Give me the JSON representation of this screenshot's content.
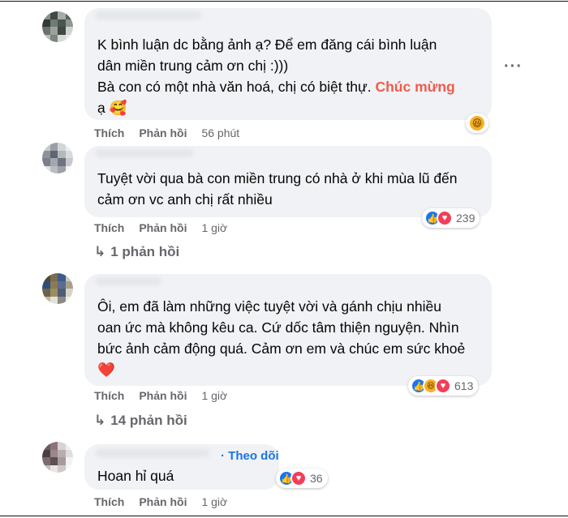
{
  "comments": [
    {
      "lines": [
        "K bình luận dc bằng ảnh ạ? Để em đăng cái bình luận",
        "dân miền trung cảm ơn chị :)))",
        "Bà con có một nhà văn hoá, chị có biệt thự. "
      ],
      "highlight": "Chúc mừng",
      "last_line": "ạ 🥰",
      "like": "Thích",
      "reply": "Phản hồi",
      "time": "56 phút",
      "reaction_icon": "haha-icon"
    },
    {
      "lines": [
        "Tuyệt vời qua bà con miền trung có nhà ở khi mùa lũ đến",
        "cảm ơn vc anh chị rất nhiều"
      ],
      "like": "Thích",
      "reply": "Phản hồi",
      "time": "1 giờ",
      "reaction_count": "239",
      "replies": "1 phản hồi"
    },
    {
      "lines": [
        "Ôi, em đã làm những việc tuyệt vời và gánh chịu nhiều",
        "oan ức mà không kêu ca. Cứ dốc tâm thiện nguyện. Nhìn",
        "bức ảnh cảm động quá. Cảm ơn em và chúc em sức khoẻ",
        "❤️"
      ],
      "like": "Thích",
      "reply": "Phản hồi",
      "time": "1 giờ",
      "reaction_count": "613",
      "replies": "14 phản hồi"
    },
    {
      "follow": "Theo dõi",
      "lines": [
        "Hoan hỉ quá"
      ],
      "like": "Thích",
      "reply": "Phản hồi",
      "time": "1 giờ",
      "reaction_count": "36"
    }
  ],
  "more_menu": "···",
  "reply_arrow": "↳",
  "colors": {
    "bubble": "#f0f2f5",
    "highlight": "#f05a4b",
    "meta": "#65676b",
    "like": "#1877f2",
    "love": "#f33e58",
    "haha": "#f7b125"
  }
}
